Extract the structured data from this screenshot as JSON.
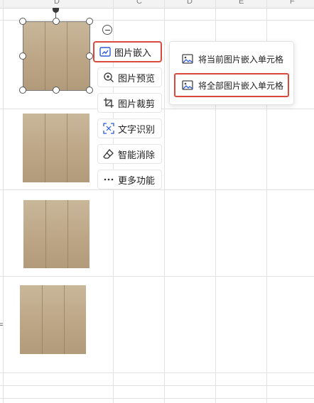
{
  "sheet": {
    "column_headers": [
      "D",
      "C",
      "D",
      "E",
      "F"
    ],
    "row_mark": "="
  },
  "toolbar": {
    "collapse_label": "",
    "buttons": [
      {
        "label": "图片嵌入",
        "icon": "image-embed-icon"
      },
      {
        "label": "图片预览",
        "icon": "zoom-in-icon"
      },
      {
        "label": "图片裁剪",
        "icon": "crop-icon"
      },
      {
        "label": "文字识别",
        "icon": "ocr-scan-icon"
      },
      {
        "label": "智能消除",
        "icon": "eraser-icon"
      },
      {
        "label": "更多功能",
        "icon": "more-dots-icon"
      }
    ]
  },
  "submenu": {
    "items": [
      {
        "label": "将当前图片嵌入单元格",
        "icon": "image-icon"
      },
      {
        "label": "将全部图片嵌入单元格",
        "icon": "image-icon"
      }
    ]
  },
  "colors": {
    "highlight": "#d94a3d",
    "accent": "#2b5bd7",
    "gridline": "#e2e2e2"
  }
}
